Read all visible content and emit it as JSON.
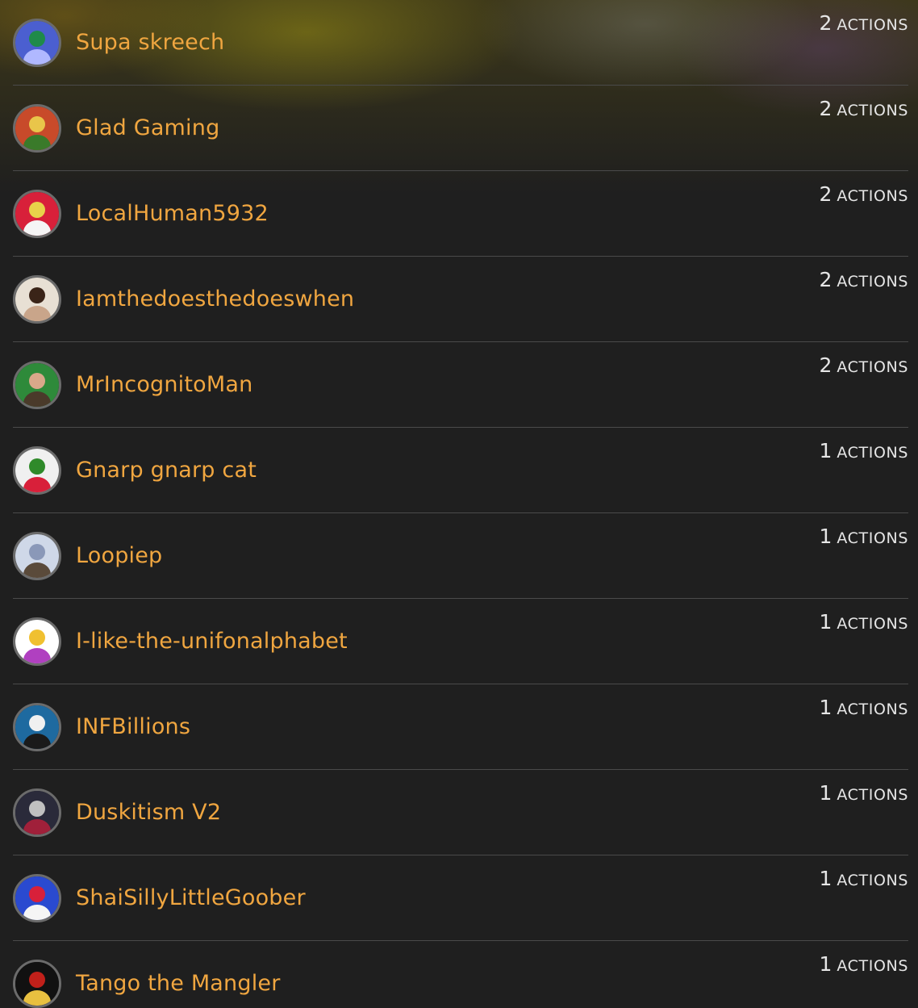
{
  "rows": [
    {
      "name": "Supa skreech",
      "count": "2",
      "label": "ACTIONS",
      "avatar": "blue-figure-avatar",
      "colors": [
        "#4b5fd0",
        "#1f8a4a",
        "#b0b8ff"
      ]
    },
    {
      "name": "Glad Gaming",
      "count": "2",
      "label": "ACTIONS",
      "avatar": "striped-santa-avatar",
      "colors": [
        "#c84a2a",
        "#e9c54a",
        "#3a7a2a"
      ]
    },
    {
      "name": "LocalHuman5932",
      "count": "2",
      "label": "ACTIONS",
      "avatar": "yellow-santa-avatar",
      "colors": [
        "#d8203a",
        "#e8d24a",
        "#f5f5f5"
      ]
    },
    {
      "name": "Iamthedoesthedoeswhen",
      "count": "2",
      "label": "ACTIONS",
      "avatar": "dark-hair-avatar",
      "colors": [
        "#e8e0d4",
        "#3a2418",
        "#c9a58a"
      ]
    },
    {
      "name": "MrIncognitoMan",
      "count": "2",
      "label": "ACTIONS",
      "avatar": "face-photo-avatar",
      "colors": [
        "#2e8a3a",
        "#d9a88a",
        "#4a3a2a"
      ]
    },
    {
      "name": "Gnarp gnarp cat",
      "count": "1",
      "label": "ACTIONS",
      "avatar": "christmas-tree-avatar",
      "colors": [
        "#f0f0f0",
        "#2f8a2a",
        "#d8203a"
      ]
    },
    {
      "name": "Loopiep",
      "count": "1",
      "label": "ACTIONS",
      "avatar": "waving-man-avatar",
      "colors": [
        "#cfd8e8",
        "#8a98b8",
        "#5a4a3a"
      ]
    },
    {
      "name": "I-like-the-unifonalphabet",
      "count": "1",
      "label": "ACTIONS",
      "avatar": "colorful-blob-avatar",
      "colors": [
        "#ffffff",
        "#f0c030",
        "#b040c0"
      ]
    },
    {
      "name": "INFBillions",
      "count": "1",
      "label": "ACTIONS",
      "avatar": "robot-face-avatar",
      "colors": [
        "#1e6aa0",
        "#f0f0f0",
        "#1a1a1a"
      ]
    },
    {
      "name": "Duskitism V2",
      "count": "1",
      "label": "ACTIONS",
      "avatar": "skull-avatar",
      "colors": [
        "#2a2a3a",
        "#c0c0c0",
        "#a0203a"
      ]
    },
    {
      "name": "ShaiSillyLittleGoober",
      "count": "1",
      "label": "ACTIONS",
      "avatar": "blue-santa-avatar",
      "colors": [
        "#2a4ad0",
        "#d8203a",
        "#f5f5f5"
      ]
    },
    {
      "name": "Tango the Mangler",
      "count": "1",
      "label": "ACTIONS",
      "avatar": "dark-figure-avatar",
      "colors": [
        "#111111",
        "#c0201a",
        "#e8c040"
      ]
    }
  ]
}
